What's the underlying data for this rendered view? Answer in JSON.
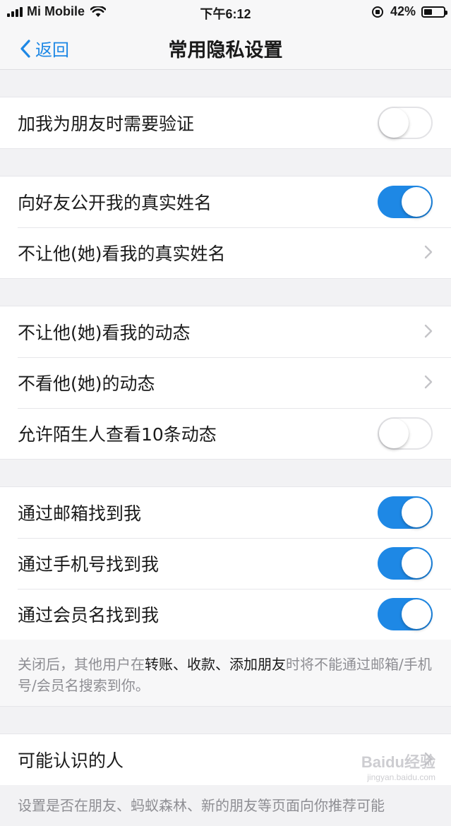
{
  "status_bar": {
    "carrier": "Mi Mobile",
    "time": "下午6:12",
    "battery": "42%",
    "battery_level": 0.42,
    "icons": [
      "signal-icon",
      "wifi-icon",
      "rotation-lock-icon",
      "battery-icon"
    ]
  },
  "nav": {
    "back_label": "返回",
    "title": "常用隐私设置"
  },
  "group1": {
    "verify_label": "加我为朋友时需要验证",
    "verify_on": false
  },
  "group2": {
    "show_real_name_label": "向好友公开我的真实姓名",
    "show_real_name_on": true,
    "hide_real_name_label": "不让他(她)看我的真实姓名"
  },
  "group3": {
    "hide_moments_label": "不让他(她)看我的动态",
    "not_see_label": "不看他(她)的动态",
    "stranger_label": "允许陌生人查看10条动态",
    "stranger_on": false
  },
  "group4": {
    "email_label": "通过邮箱找到我",
    "email_on": true,
    "phone_label": "通过手机号找到我",
    "phone_on": true,
    "member_label": "通过会员名找到我",
    "member_on": true,
    "note_part1": "关闭后，其他用户在",
    "note_highlight": "转账、收款、添加朋友",
    "note_part2": "时将不能通过邮箱/手机号/会员名搜索到你。"
  },
  "group5": {
    "may_know_label": "可能认识的人",
    "note": "设置是否在朋友、蚂蚁森林、新的朋友等页面向你推荐可能"
  },
  "watermark": {
    "text": "Baidu经验",
    "sub": "jingyan.baidu.com"
  },
  "colors": {
    "accent": "#1e88e5",
    "background": "#f2f2f4"
  }
}
